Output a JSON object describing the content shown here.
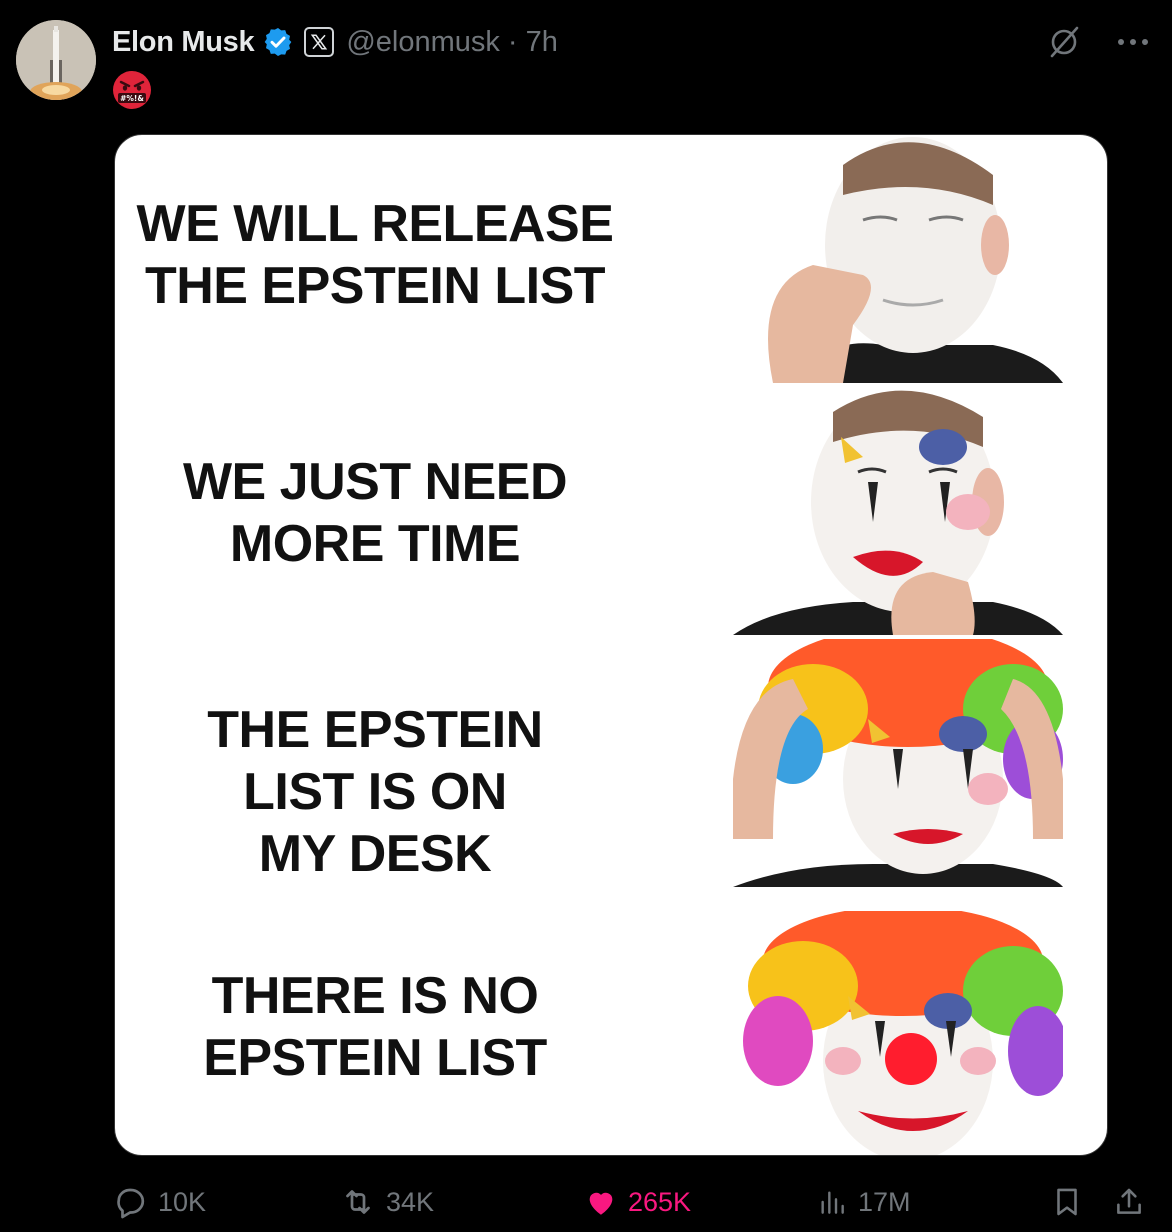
{
  "post": {
    "author_name": "Elon Musk",
    "handle": "@elonmusk",
    "separator": "·",
    "time": "7h",
    "verified": true,
    "emoji": "🤬",
    "more_label": "···"
  },
  "meme": {
    "panels": [
      "WE WILL RELEASE\nTHE EPSTEIN LIST",
      "WE JUST NEED\nMORE TIME",
      "THE EPSTEIN\nLIST IS ON\nMY DESK",
      "THERE IS NO\nEPSTEIN LIST"
    ]
  },
  "actions": {
    "replies": "10K",
    "reposts": "34K",
    "likes": "265K",
    "views": "17M"
  },
  "colors": {
    "background": "#000000",
    "verified": "#1d9bf0",
    "like": "#f91880",
    "muted": "#71767b"
  },
  "icons": [
    "reply-icon",
    "repost-icon",
    "heart-icon",
    "views-icon",
    "bookmark-icon",
    "share-icon",
    "grok-icon",
    "more-icon",
    "verified-icon",
    "x-badge-icon"
  ]
}
